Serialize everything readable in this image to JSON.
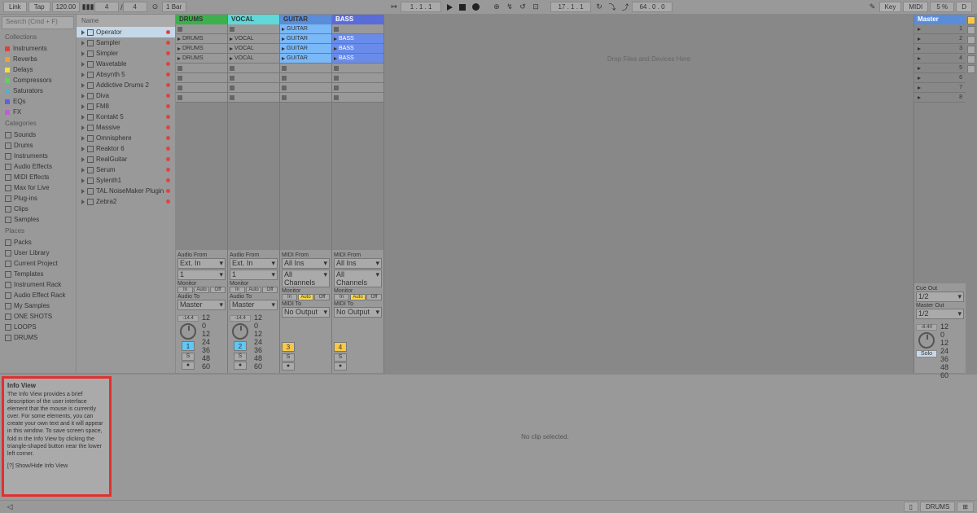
{
  "topbar": {
    "link": "Link",
    "tap": "Tap",
    "tempo": "120.00",
    "sig1": "4",
    "sig2": "4",
    "bars": "1 Bar",
    "pos": "1 .  1 .  1",
    "arr_pos": "17 .  1 .  1",
    "vel": "64 .  0 .  0",
    "pencil": "✎",
    "key": "Key",
    "midi": "MIDI",
    "pct": "5 %",
    "dlabel": "D"
  },
  "browser": {
    "search": "Search (Cmd + F)",
    "collections_hdr": "Collections",
    "collections": [
      {
        "label": "Instruments",
        "color": "#e04040"
      },
      {
        "label": "Reverbs",
        "color": "#f0a030"
      },
      {
        "label": "Delays",
        "color": "#f0e040"
      },
      {
        "label": "Compressors",
        "color": "#60d060"
      },
      {
        "label": "Saturators",
        "color": "#50b0d0"
      },
      {
        "label": "EQs",
        "color": "#6060e0"
      },
      {
        "label": "FX",
        "color": "#c060d0"
      }
    ],
    "categories_hdr": "Categories",
    "categories": [
      "Sounds",
      "Drums",
      "Instruments",
      "Audio Effects",
      "MIDI Effects",
      "Max for Live",
      "Plug-ins",
      "Clips",
      "Samples"
    ],
    "places_hdr": "Places",
    "places": [
      "Packs",
      "User Library",
      "Current Project",
      "Templates",
      "Instrument Rack",
      "Audio Effect Rack",
      "My Samples",
      "ONE SHOTS",
      "LOOPS",
      "DRUMS"
    ],
    "name_hdr": "Name",
    "devices": [
      "Operator",
      "Sampler",
      "Simpler",
      "Wavetable",
      "Absynth 5",
      "Addictive Drums 2",
      "Diva",
      "FM8",
      "Kontakt 5",
      "Massive",
      "Omnisphere",
      "Reaktor 6",
      "RealGuitar",
      "Serum",
      "Sylenth1",
      "TAL NoiseMaker Plugin",
      "Zebra2"
    ]
  },
  "tracks": {
    "t1": {
      "name": "DRUMS",
      "clips": [
        "",
        "DRUMS",
        "DRUMS",
        "DRUMS",
        "",
        "",
        "",
        ""
      ]
    },
    "t2": {
      "name": "VOCAL",
      "clips": [
        "",
        "VOCAL",
        "VOCAL",
        "VOCAL",
        "",
        "",
        "",
        ""
      ]
    },
    "t3": {
      "name": "GUITAR",
      "clips": [
        "GUITAR",
        "GUITAR",
        "GUITAR",
        "GUITAR",
        "",
        "",
        "",
        ""
      ]
    },
    "t4": {
      "name": "BASS",
      "clips": [
        "",
        "BASS",
        "BASS",
        "BASS",
        "",
        "",
        "",
        ""
      ]
    },
    "drop": "Drop Files and Devices Here",
    "master": "Master",
    "scenes": [
      "1",
      "2",
      "3",
      "4",
      "5",
      "6",
      "7",
      "8"
    ]
  },
  "io": {
    "af": "Audio From",
    "mf": "MIDI From",
    "extin": "Ext. In",
    "allins": "All Ins",
    "ch1": "1",
    "allch": "All Channels",
    "mon": "Monitor",
    "in": "In",
    "auto": "Auto",
    "off": "Off",
    "at": "Audio To",
    "mt": "MIDI To",
    "master": "Master",
    "noout": "No Output",
    "db": "-14.4",
    "mdb": "-8.40",
    "m12": "12",
    "m0": "0",
    "m12n": "12",
    "m24": "24",
    "m36": "36",
    "m48": "48",
    "m60": "60",
    "num1": "1",
    "num2": "2",
    "num3": "3",
    "num4": "4",
    "s": "S",
    "solo": "Solo",
    "cueout": "Cue Out",
    "masterout": "Master Out",
    "half": "1/2"
  },
  "info": {
    "title": "Info View",
    "body": "The Info View provides a brief description of the user interface element that the mouse is currently over. For some elements, you can create your own text and it will appear in this window.\nTo save screen space, fold in the Info View by clicking the triangle-shaped button near the lower left corner.",
    "shortcut": "[?] Show/Hide Info View"
  },
  "clipview": "No clip selected.",
  "status": {
    "drums": "DRUMS"
  }
}
